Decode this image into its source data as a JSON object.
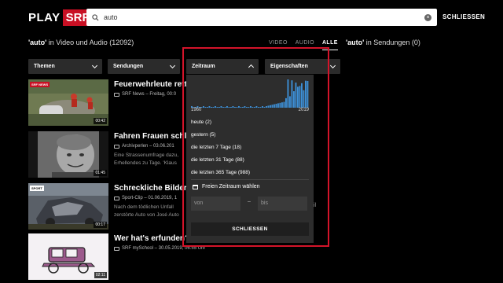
{
  "header": {
    "logo_play": "PLAY",
    "logo_srf": "SRF",
    "search_value": "auto",
    "close_label": "SCHLIESSEN"
  },
  "results": {
    "query": "'auto'",
    "video_audio_text": "in Video und Audio (12092)",
    "tabs": [
      "VIDEO",
      "AUDIO",
      "ALLE"
    ],
    "active_tab": "ALLE",
    "shows_query": "'auto'",
    "shows_text": "in Sendungen (0)"
  },
  "filters": {
    "themen": "Themen",
    "sendungen": "Sendungen",
    "zeitraum": "Zeitraum",
    "eigenschaften": "Eigenschaften"
  },
  "items": [
    {
      "title": "Feuerwehrleute retten",
      "meta": "SRF News – Freitag, 00:0",
      "desc": "",
      "duration": "00:42",
      "badge": "SRF NEWS"
    },
    {
      "title": "Fahren Frauen schlecht",
      "meta": "Archivperlen – 03.06.201",
      "desc1": "Eine Strassenumfrage dazu,",
      "desc2": "Erhellendes zu Tage. 'Klaus",
      "duration": "01:45"
    },
    {
      "title": "Schreckliche Bilder vo",
      "meta": "Sport-Clip – 01.06.2019, 1",
      "desc1": "Nach dem tödlichen Unfall",
      "desc2": "zerstörte Auto von José Auto",
      "duration": "00:17",
      "badge": "SPORT"
    },
    {
      "title": "Wer hat's erfunden? - G",
      "meta": "SRF mySchool – 30.05.2019, 06:55 Uhr",
      "desc": "",
      "duration": "02:11"
    }
  ],
  "peek": {
    "row3": "il",
    "row3b": ""
  },
  "zeitraum_panel": {
    "axis_start": "1960",
    "axis_end": "2019",
    "options": [
      "heute (2)",
      "gestern (5)",
      "die letzten 7 Tage (18)",
      "die letzten 31 Tage (88)",
      "die letzten 365 Tage (988)"
    ],
    "custom_range_label": "Freien Zeitraum wählen",
    "from_placeholder": "von",
    "to_placeholder": "bis",
    "separator": "–",
    "close_label": "SCHLIESSEN",
    "histogram_color": "#3d8fd6"
  }
}
